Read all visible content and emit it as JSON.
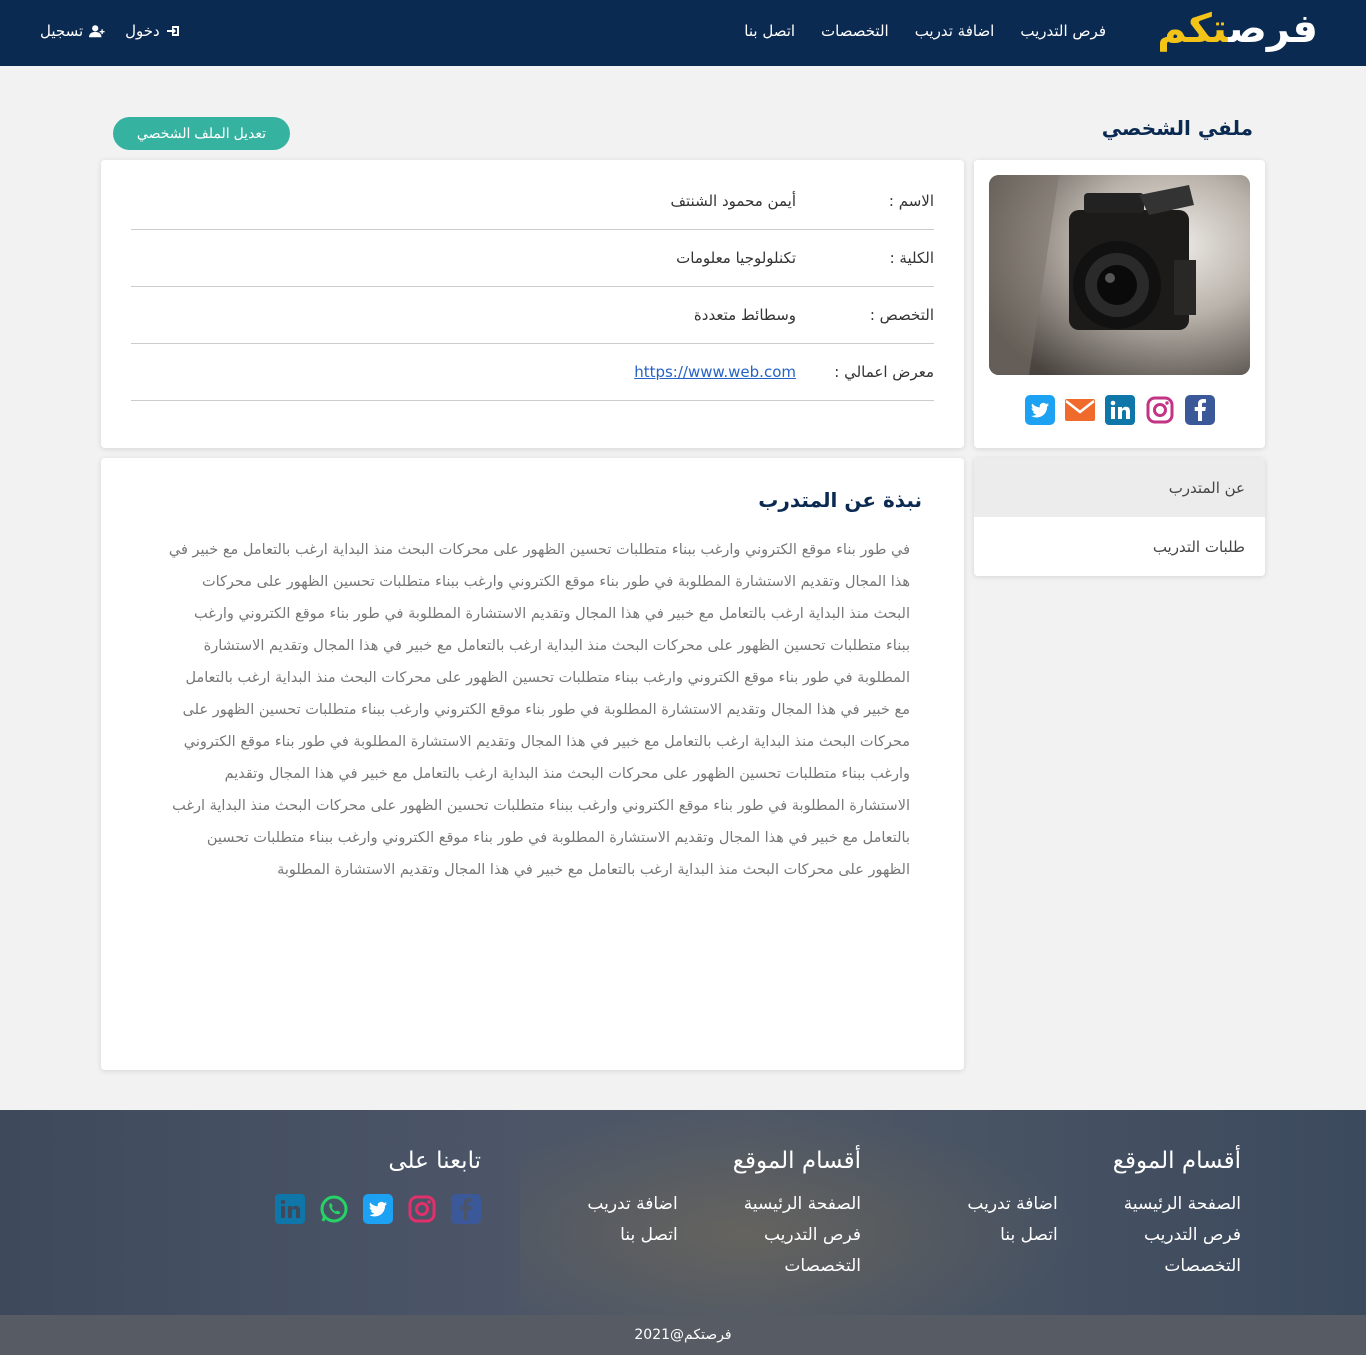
{
  "brand": {
    "part1": "فرص",
    "part2": "تكم"
  },
  "nav": {
    "links": [
      "فرص التدريب",
      "اضافة تدريب",
      "التخصصات",
      "اتصل بنا"
    ],
    "login": "دخول",
    "register": "تسجيل"
  },
  "profile": {
    "title": "ملفي الشخصي",
    "edit_button": "تعديل الملف الشخصي",
    "fields": [
      {
        "label": "الاسم :",
        "value": "أيمن محمود الشنتف"
      },
      {
        "label": "الكلية :",
        "value": "تكنلولوجيا معلومات"
      },
      {
        "label": "التخصص :",
        "value": "وسطائط متعددة"
      },
      {
        "label": "معرض اعمالي :",
        "value": "https://www.web.com"
      }
    ]
  },
  "socials": [
    "facebook-icon",
    "instagram-icon",
    "linkedin-icon",
    "email-icon",
    "twitter-icon"
  ],
  "side_menu": {
    "items": [
      "عن المتدرب",
      "طلبات التدريب"
    ]
  },
  "about": {
    "title": "نبذة عن المتدرب",
    "text": "في طور بناء موقع الكتروني وارغب ببناء متطلبات تحسين الظهور على محركات البحث منذ البداية ارغب بالتعامل مع خبير في هذا المجال وتقديم الاستشارة المطلوبة في طور بناء موقع الكتروني وارغب ببناء متطلبات تحسين الظهور على محركات البحث منذ البداية ارغب بالتعامل مع خبير في هذا المجال وتقديم الاستشارة المطلوبة في طور بناء موقع الكتروني وارغب ببناء متطلبات تحسين الظهور على محركات البحث منذ البداية ارغب بالتعامل مع خبير في هذا المجال وتقديم الاستشارة المطلوبة في طور بناء موقع الكتروني وارغب ببناء متطلبات تحسين الظهور على محركات البحث منذ البداية ارغب بالتعامل مع خبير في هذا المجال وتقديم الاستشارة المطلوبة في طور بناء موقع الكتروني وارغب ببناء متطلبات تحسين الظهور على محركات البحث منذ البداية ارغب بالتعامل مع خبير في هذا المجال وتقديم الاستشارة المطلوبة في طور بناء موقع الكتروني وارغب ببناء متطلبات تحسين الظهور على محركات البحث منذ البداية ارغب بالتعامل مع خبير في هذا المجال وتقديم الاستشارة المطلوبة في طور بناء موقع الكتروني وارغب ببناء متطلبات تحسين الظهور على محركات البحث منذ البداية ارغب بالتعامل مع خبير في هذا المجال وتقديم الاستشارة المطلوبة في طور بناء موقع الكتروني وارغب ببناء متطلبات تحسين الظهور على محركات البحث منذ البداية ارغب بالتعامل مع خبير في هذا المجال وتقديم الاستشارة المطلوبة"
  },
  "footer": {
    "col1": {
      "title": "أقسام الموقع",
      "links": [
        "الصفحة الرئيسية",
        "اضافة تدريب",
        "فرص التدريب",
        "اتصل بنا",
        "التخصصات"
      ]
    },
    "col2": {
      "title": "أقسام الموقع",
      "links": [
        "الصفحة الرئيسية",
        "اضافة تدريب",
        "فرص التدريب",
        "اتصل بنا",
        "التخصصات"
      ]
    },
    "col3": {
      "title": "تابعنا على"
    },
    "socials": [
      "facebook-icon",
      "instagram-icon",
      "twitter-icon",
      "whatsapp-icon",
      "linkedin-icon"
    ],
    "copyright": "فرصتكم@2021"
  },
  "colors": {
    "navbar": "#0b2a52",
    "brand_accent": "#f3c318",
    "edit_button": "#35b3a0",
    "link": "#2563c7"
  }
}
